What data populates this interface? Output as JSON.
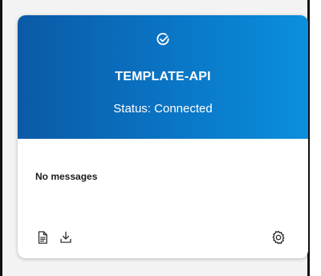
{
  "card": {
    "title": "TEMPLATE-API",
    "status": "Status: Connected",
    "messages": "No messages",
    "status_icon": "check-circle-icon",
    "actions": [
      "document-icon",
      "download-icon",
      "settings-gear-icon"
    ],
    "colors": {
      "header_start": "#0b5aa6",
      "header_end": "#0b8fdc",
      "header_text": "#ffffff",
      "icon": "#333333"
    }
  }
}
